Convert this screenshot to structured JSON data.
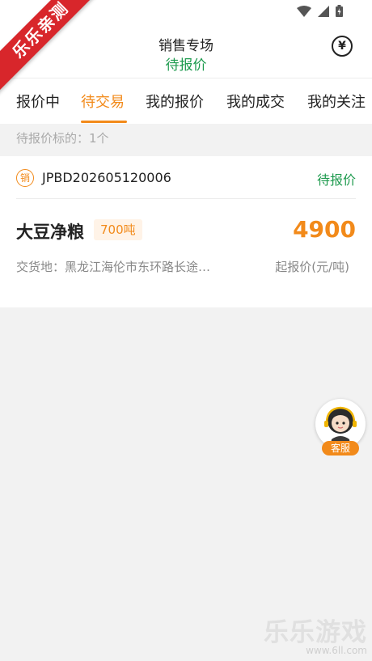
{
  "watermark": {
    "ribbon_text": "乐乐亲测",
    "brand_text": "乐乐游戏",
    "url_text": "www.6ll.com"
  },
  "header": {
    "title": "销售专场",
    "subtitle": "待报价",
    "yen_symbol": "¥"
  },
  "tabs": [
    {
      "label": "报价中",
      "active": false
    },
    {
      "label": "待交易",
      "active": true
    },
    {
      "label": "我的报价",
      "active": false
    },
    {
      "label": "我的成交",
      "active": false
    },
    {
      "label": "我的关注",
      "active": false
    }
  ],
  "summary": {
    "text": "待报价标的：1个"
  },
  "listing": {
    "type_badge": "销",
    "order_no": "JPBD202605120006",
    "status": "待报价",
    "product": "大豆净粮",
    "quantity": "700吨",
    "price": "4900",
    "delivery": "交货地：黑龙江海伦市东环路长途…",
    "price_unit": "起报价(元/吨)"
  },
  "service": {
    "label": "客服"
  },
  "colors": {
    "accent": "#f28a1a",
    "green": "#1f9b4f",
    "ribbon": "#d8262b"
  }
}
